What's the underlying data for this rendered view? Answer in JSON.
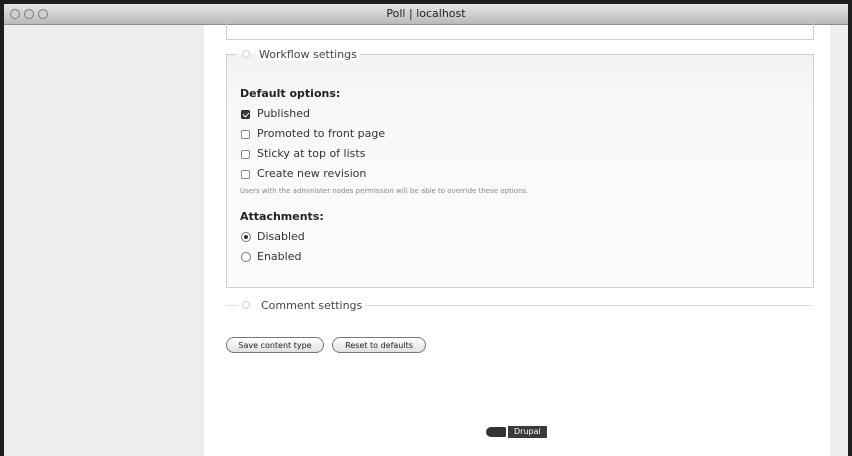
{
  "window": {
    "title": "Poll | localhost"
  },
  "workflow": {
    "legend": "Workflow settings",
    "default_options": {
      "label": "Default options:",
      "items": [
        {
          "label": "Published",
          "checked": true
        },
        {
          "label": "Promoted to front page",
          "checked": false
        },
        {
          "label": "Sticky at top of lists",
          "checked": false
        },
        {
          "label": "Create new revision",
          "checked": false
        }
      ],
      "description": "Users with the administer nodes permission will be able to override these options."
    },
    "attachments": {
      "label": "Attachments:",
      "options": [
        {
          "label": "Disabled",
          "selected": true
        },
        {
          "label": "Enabled",
          "selected": false
        }
      ]
    }
  },
  "comment": {
    "legend": "Comment settings"
  },
  "buttons": {
    "save": "Save content type",
    "reset": "Reset to defaults"
  },
  "footer": {
    "badge": "Drupal"
  }
}
